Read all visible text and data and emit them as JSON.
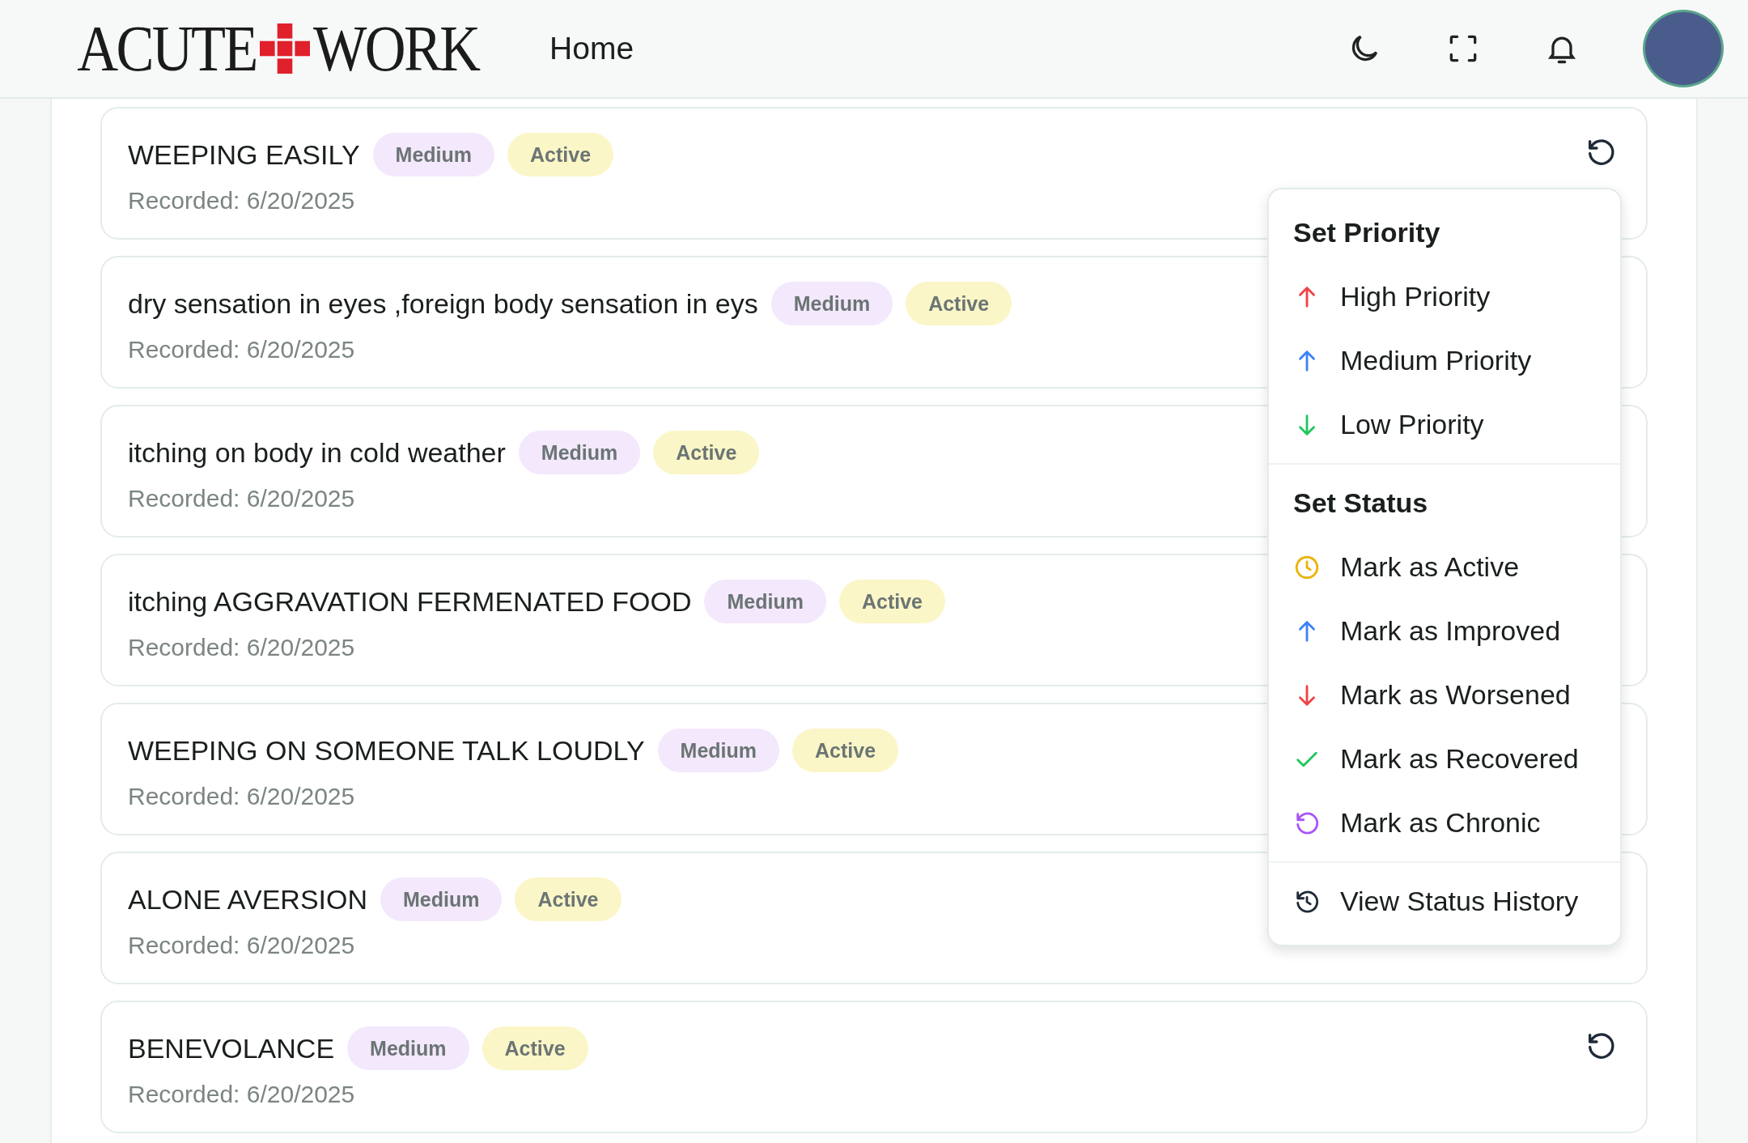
{
  "header": {
    "logo_left": "ACUTE",
    "logo_right": "WORK",
    "nav_link": "Home"
  },
  "symptoms": [
    {
      "title": "WEEPING EASILY",
      "priority": "Medium",
      "status": "Active",
      "recorded": "Recorded: 6/20/2025",
      "history_button": true
    },
    {
      "title": "dry sensation in eyes ,foreign body sensation in eys",
      "priority": "Medium",
      "status": "Active",
      "recorded": "Recorded: 6/20/2025",
      "history_button": false
    },
    {
      "title": "itching on body in cold weather",
      "priority": "Medium",
      "status": "Active",
      "recorded": "Recorded: 6/20/2025",
      "history_button": false
    },
    {
      "title": "itching AGGRAVATION FERMENATED FOOD",
      "priority": "Medium",
      "status": "Active",
      "recorded": "Recorded: 6/20/2025",
      "history_button": false
    },
    {
      "title": "WEEPING ON SOMEONE TALK LOUDLY",
      "priority": "Medium",
      "status": "Active",
      "recorded": "Recorded: 6/20/2025",
      "history_button": false
    },
    {
      "title": "ALONE AVERSION",
      "priority": "Medium",
      "status": "Active",
      "recorded": "Recorded: 6/20/2025",
      "history_button": false
    },
    {
      "title": "BENEVOLANCE",
      "priority": "Medium",
      "status": "Active",
      "recorded": "Recorded: 6/20/2025",
      "history_button": true
    }
  ],
  "menu": {
    "sections": [
      {
        "heading": "Set Priority",
        "items": [
          {
            "label": "High Priority",
            "kind": "up",
            "color": "#ef4444"
          },
          {
            "label": "Medium Priority",
            "kind": "up",
            "color": "#3b82f6"
          },
          {
            "label": "Low Priority",
            "kind": "down",
            "color": "#22c55e"
          }
        ]
      },
      {
        "heading": "Set Status",
        "items": [
          {
            "label": "Mark as Active",
            "kind": "clock",
            "color": "#eab308"
          },
          {
            "label": "Mark as Improved",
            "kind": "up",
            "color": "#3b82f6"
          },
          {
            "label": "Mark as Worsened",
            "kind": "down",
            "color": "#ef4444"
          },
          {
            "label": "Mark as Recovered",
            "kind": "check",
            "color": "#22c55e"
          },
          {
            "label": "Mark as Chronic",
            "kind": "undo",
            "color": "#a855f7"
          }
        ]
      },
      {
        "items": [
          {
            "label": "View Status History",
            "kind": "history",
            "color": "#1f2937"
          }
        ]
      }
    ]
  }
}
